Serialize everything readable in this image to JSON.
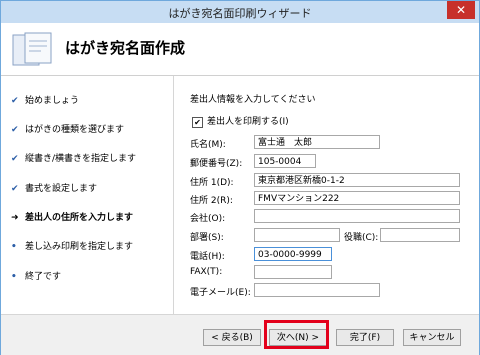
{
  "window": {
    "title": "はがき宛名面印刷ウィザード",
    "close_label": "✕"
  },
  "header": {
    "title": "はがき宛名面作成"
  },
  "steps": [
    {
      "mark": "✔",
      "label": "始めましょう"
    },
    {
      "mark": "✔",
      "label": "はがきの種類を選びます"
    },
    {
      "mark": "✔",
      "label": "縦書き/横書きを指定します"
    },
    {
      "mark": "✔",
      "label": "書式を設定します"
    },
    {
      "mark": "➜",
      "label": "差出人の住所を入力します"
    },
    {
      "mark": "•",
      "label": "差し込み印刷を指定します"
    },
    {
      "mark": "•",
      "label": "終了です"
    }
  ],
  "form": {
    "instruction": "差出人情報を入力してください",
    "print_sender": {
      "label": "差出人を印刷する(I)",
      "checked_mark": "✔"
    },
    "fields": {
      "name": {
        "label": "氏名(M):",
        "value": "富士通　太郎"
      },
      "postal": {
        "label": "郵便番号(Z):",
        "value": "105-0004"
      },
      "address1": {
        "label": "住所 1(D):",
        "value": "東京都港区新橋0-1-2"
      },
      "address2": {
        "label": "住所 2(R):",
        "value": "FMVマンション222"
      },
      "company": {
        "label": "会社(O):",
        "value": ""
      },
      "department": {
        "label": "部署(S):",
        "value": ""
      },
      "position": {
        "label": "役職(C):",
        "value": ""
      },
      "phone": {
        "label": "電話(H):",
        "value": "03-0000-9999"
      },
      "fax": {
        "label": "FAX(T):",
        "value": ""
      },
      "email": {
        "label": "電子メール(E):",
        "value": ""
      }
    }
  },
  "footer": {
    "back": "< 戻る(B)",
    "next": "次へ(N) >",
    "finish": "完了(F)",
    "cancel": "キャンセル"
  },
  "colors": {
    "highlight": "#e3001b",
    "focus_border": "#4a90d9"
  }
}
